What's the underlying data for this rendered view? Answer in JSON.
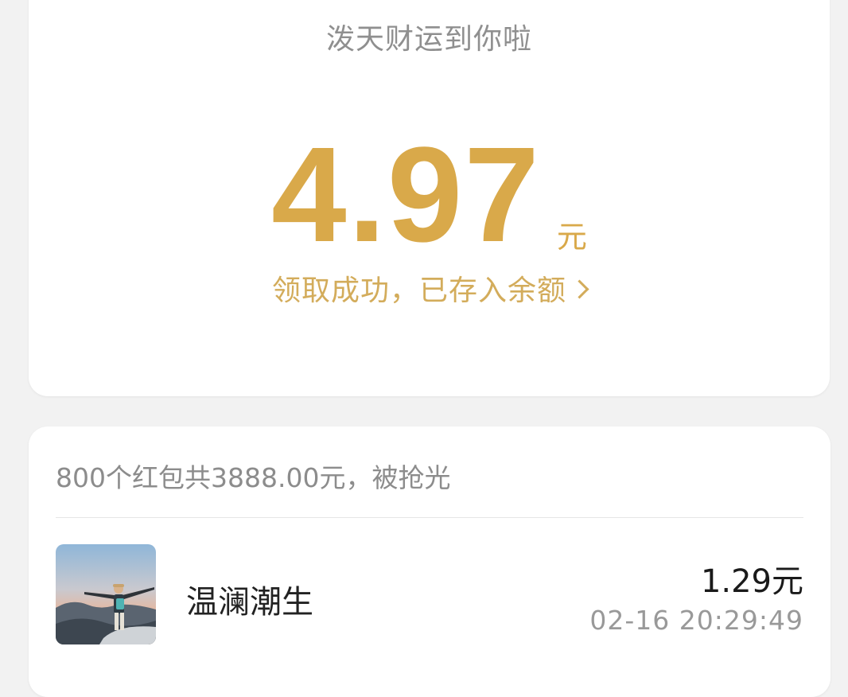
{
  "packet": {
    "greeting": "泼天财运到你啦",
    "amount": "4.97",
    "unit": "元",
    "status_text": "领取成功，已存入余额"
  },
  "summary": {
    "text": "800个红包共3888.00元，被抢光"
  },
  "records": [
    {
      "name": "温澜潮生",
      "amount": "1.29元",
      "time": "02-16 20:29:49",
      "avatar_icon": "avatar-photo"
    }
  ],
  "colors": {
    "gold": "#d9a94a",
    "link_gold": "#d3ac5b",
    "background": "#f2f2f2"
  }
}
